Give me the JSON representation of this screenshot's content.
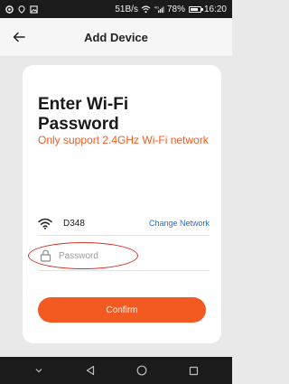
{
  "status_bar": {
    "speed": "51B/s",
    "battery_level": 0.78,
    "battery": "78%",
    "time": "16:20",
    "signal_label": "4G"
  },
  "header": {
    "title": "Add Device",
    "back_icon": "back-arrow-icon"
  },
  "card": {
    "title": "Enter Wi-Fi Password",
    "warning": "Only support 2.4GHz Wi-Fi network",
    "wifi": {
      "icon": "wifi-icon",
      "name": "D348",
      "change_label": "Change Network"
    },
    "password": {
      "icon": "lock-icon",
      "placeholder": "Password",
      "value": ""
    },
    "confirm_label": "Confirm"
  },
  "nav_bar": {
    "items": [
      "chevron-down-icon",
      "back-triangle-icon",
      "home-circle-icon",
      "recents-square-icon"
    ]
  },
  "colors": {
    "accent": "#f25a21",
    "link": "#2c6bd6",
    "highlight": "#d0352a"
  }
}
